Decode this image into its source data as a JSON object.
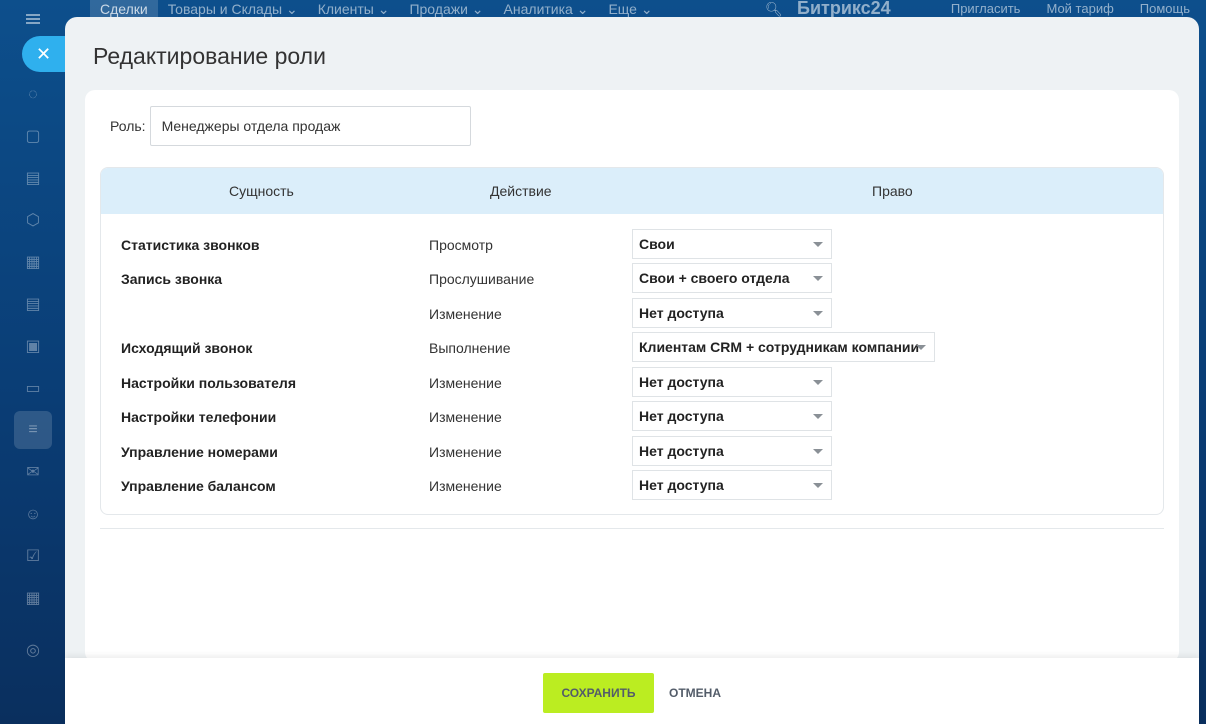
{
  "topbar": {
    "nav": [
      "Сделки",
      "Товары и Склады ⌄",
      "Клиенты ⌄",
      "Продажи ⌄",
      "Аналитика ⌄",
      "Еще ⌄"
    ],
    "brand": "Битрикс24",
    "invite": "Пригласить",
    "tariff": "Мой тариф",
    "help": "Помощь"
  },
  "slider": {
    "title": "Редактирование роли",
    "role_label": "Роль:",
    "role_value": "Менеджеры отдела продаж"
  },
  "table": {
    "headers": {
      "entity": "Сущность",
      "action": "Действие",
      "right": "Право"
    },
    "rows": [
      {
        "entity": "Статистика звонков",
        "action": "Просмотр",
        "right": "Свои"
      },
      {
        "entity": "Запись звонка",
        "action": "Прослушивание",
        "right": "Свои + своего отдела"
      },
      {
        "entity": "",
        "action": "Изменение",
        "right": "Нет доступа"
      },
      {
        "entity": "Исходящий звонок",
        "action": "Выполнение",
        "right": "Клиентам CRM + сотрудникам компании"
      },
      {
        "entity": "Настройки пользователя",
        "action": "Изменение",
        "right": "Нет доступа"
      },
      {
        "entity": "Настройки телефонии",
        "action": "Изменение",
        "right": "Нет доступа"
      },
      {
        "entity": "Управление номерами",
        "action": "Изменение",
        "right": "Нет доступа"
      },
      {
        "entity": "Управление балансом",
        "action": "Изменение",
        "right": "Нет доступа"
      }
    ]
  },
  "footer": {
    "save": "Сохранить",
    "cancel": "Отмена"
  },
  "colors": {
    "accent": "#bbed21",
    "header_bg": "#dbeefa",
    "close": "#2fb0ee"
  }
}
